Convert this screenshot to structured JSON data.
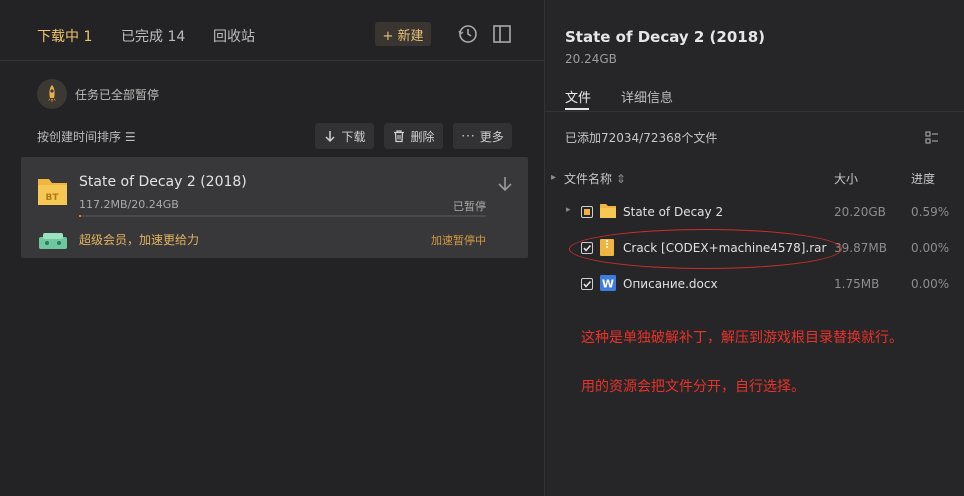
{
  "left": {
    "tabs": [
      {
        "label": "下载中 1",
        "active": true
      },
      {
        "label": "已完成 14",
        "active": false
      },
      {
        "label": "回收站",
        "active": false
      }
    ],
    "new_button": "+ 新建",
    "status_text": "任务已全部暂停",
    "sort_label": "按创建时间排序 ☰",
    "actions": {
      "download": "下载",
      "delete": "删除",
      "more": "更多"
    },
    "task": {
      "title": "State of Decay 2 (2018)",
      "size": "117.2MB/20.24GB",
      "state": "已暂停",
      "progress_fraction": 0.006,
      "vip_text": "超级会员，加速更给力",
      "vip_state": "加速暂停中"
    }
  },
  "right": {
    "title": "State of Decay 2 (2018)",
    "size": "20.24GB",
    "tabs": [
      {
        "label": "文件",
        "active": true
      },
      {
        "label": "详细信息",
        "active": false
      }
    ],
    "added_text": "已添加72034/72368个文件",
    "columns": {
      "name": "文件名称",
      "size": "大小",
      "progress": "进度"
    },
    "files": [
      {
        "name": "State of Decay 2",
        "size": "20.20GB",
        "progress": "0.59%",
        "type": "folder",
        "check": "partial"
      },
      {
        "name": "Crack [CODEX+machine4578].rar",
        "size": "39.87MB",
        "progress": "0.00%",
        "type": "archive",
        "check": "checked"
      },
      {
        "name": "Описание.docx",
        "size": "1.75MB",
        "progress": "0.00%",
        "type": "word",
        "check": "checked"
      }
    ]
  },
  "annotations": [
    "这种是单独破解补丁，解压到游戏根目录替换就行。",
    "用的资源会把文件分开，自行选择。"
  ],
  "colors": {
    "accent": "#f0c36a",
    "progress": "#e57b2a",
    "annotation": "#e8322a"
  }
}
